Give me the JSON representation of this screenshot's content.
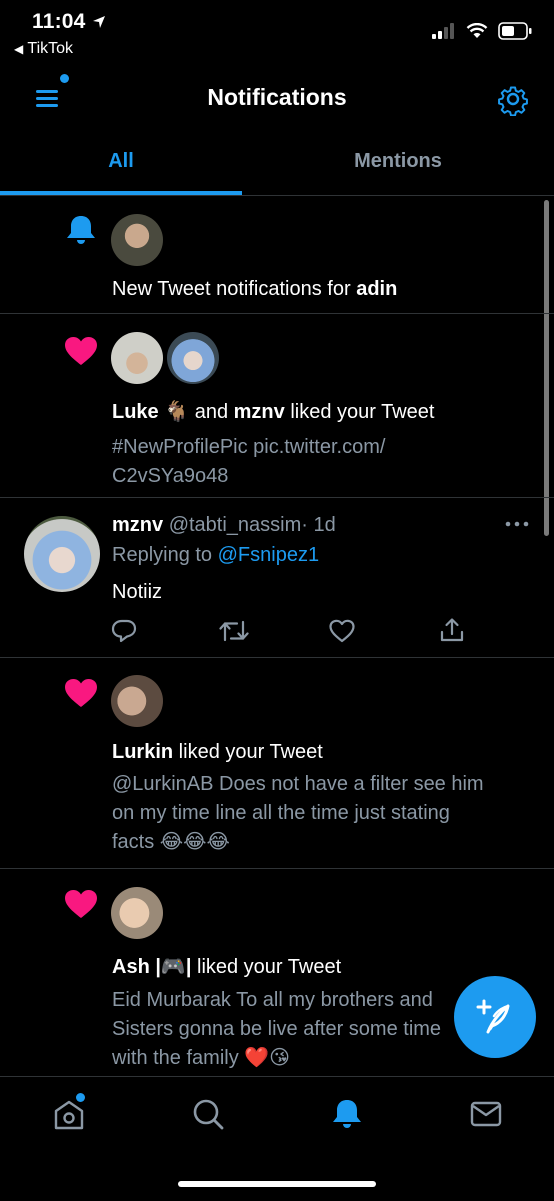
{
  "status_bar": {
    "time": "11:04",
    "back_app": "TikTok"
  },
  "header": {
    "title": "Notifications"
  },
  "tabs": [
    {
      "label": "All",
      "active": true
    },
    {
      "label": "Mentions",
      "active": false
    }
  ],
  "notifications": [
    {
      "type": "tweet-alert",
      "icon": "bell-icon",
      "text_prefix": "New Tweet notifications for ",
      "user": "adin"
    },
    {
      "type": "like",
      "icon": "heart-icon",
      "user1": "Luke",
      "user1_emoji": "🐐",
      "connector": " and ",
      "user2": "mznv",
      "action": " liked your Tweet",
      "tweet_line1": "#NewProfilePic pic.twitter.com/",
      "tweet_line2": "C2vSYa9o48"
    },
    {
      "type": "reply",
      "name": "mznv",
      "handle": "@tabti_nassim",
      "time": "· 1d",
      "replying_label": "Replying to ",
      "replying_to": "@Fsnipez1",
      "body": "Notiiz"
    },
    {
      "type": "like",
      "icon": "heart-icon",
      "user": "Lurkin",
      "action": " liked your Tweet",
      "tweet_line1": "@LurkinAB Does not have a filter see him",
      "tweet_line2": "on my time line all the time just stating",
      "tweet_line3": "facts 😂😂😂"
    },
    {
      "type": "like",
      "icon": "heart-icon",
      "user": "Ash |🎮|",
      "action": " liked your Tweet",
      "tweet_line1": "Eid Murbarak To all my brothers and",
      "tweet_line2": "Sisters gonna be live after some time",
      "tweet_line3": "with the family ❤️😘"
    }
  ],
  "colors": {
    "accent": "#1d9bf0",
    "like": "#f91880",
    "muted": "#8b98a5",
    "divider": "#2f3336"
  },
  "bottom_nav": [
    "home-icon",
    "search-icon",
    "bell-icon",
    "mail-icon"
  ]
}
